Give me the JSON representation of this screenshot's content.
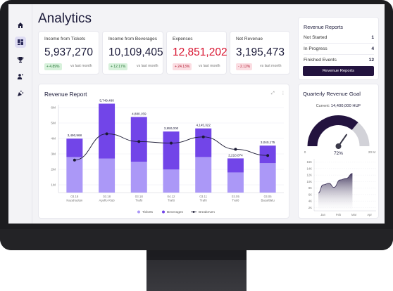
{
  "page": {
    "title": "Analytics"
  },
  "sidebar": {
    "icons": [
      "home-icon",
      "dashboard-icon",
      "trophy-icon",
      "users-icon",
      "party-icon"
    ]
  },
  "kpis": [
    {
      "label": "Income from Tickets",
      "value": "5,937,270",
      "badge": "+ 4.89%",
      "note": "vs last month",
      "trend": "up"
    },
    {
      "label": "Income from Beverages",
      "value": "10,109,405",
      "badge": "+ 12.17%",
      "note": "vs last month",
      "trend": "up"
    },
    {
      "label": "Expenses",
      "value": "12,851,202",
      "badge": "+ 24.13%",
      "note": "vs last month",
      "trend": "down"
    },
    {
      "label": "Net Revenue",
      "value": "3,195,473",
      "badge": "- 2.12%",
      "note": "vs last month",
      "trend": "down"
    }
  ],
  "revenue_reports": {
    "title": "Revenue Reports",
    "rows": [
      {
        "label": "Not Started",
        "value": "1"
      },
      {
        "label": "In Progress",
        "value": "4"
      },
      {
        "label": "Finished Events",
        "value": "12"
      }
    ],
    "button": "Revenue Reports"
  },
  "revenue_report_card": {
    "title": "Revenue Report"
  },
  "goal_card": {
    "title": "Quarterly Revenue Goal",
    "current_label": "Current:",
    "current_value": "14,400,000 HUF",
    "gauge_min": "0",
    "gauge_max": "20 M",
    "gauge_percent_label": "72%",
    "gauge_fraction": 0.72
  },
  "colors": {
    "tickets": "#ab98f7",
    "beverages": "#7245e8",
    "breakeven": "#1b1a33",
    "dark": "#23133f"
  },
  "chart_data": [
    {
      "type": "bar",
      "title": "Revenue Report",
      "categories": [
        [
          "03.18",
          "Kazahsztán"
        ],
        [
          "03.18",
          "Apollo Klub"
        ],
        [
          "03.18",
          "Trafó"
        ],
        [
          "04.12",
          "Trafó"
        ],
        [
          "03.11",
          "Trafó"
        ],
        [
          "03.05",
          "Trafó"
        ],
        [
          "03.05",
          "Bazaltfalu"
        ]
      ],
      "series": [
        {
          "name": "Tickets",
          "values": [
            2.3,
            2.2,
            2.0,
            1.5,
            2.3,
            1.3,
            1.9
          ]
        },
        {
          "name": "Beverages",
          "values": [
            1.19,
            3.55,
            2.89,
            2.45,
            1.85,
            0.91,
            1.14
          ]
        }
      ],
      "bar_labels": [
        "3,490,968",
        "5,749,480",
        "4,880,159",
        "3,950,000",
        "4,145,322",
        "2,210,074",
        "3,040,175"
      ],
      "line": {
        "name": "Breakeven",
        "values": [
          2.1,
          3.8,
          3.3,
          3.2,
          3.6,
          2.8,
          2.4
        ]
      },
      "yticks": [
        "1M",
        "2M",
        "3M",
        "4M",
        "5M",
        "6M"
      ],
      "ylim": [
        0.5,
        6
      ],
      "legend": "bottom"
    },
    {
      "type": "area",
      "categories": [
        "Jan",
        "Feb",
        "Mar",
        "Apr"
      ],
      "yticks": [
        "2K",
        "4K",
        "6K",
        "8K",
        "10K",
        "12K",
        "14K",
        "16K"
      ],
      "ylim": [
        1,
        17
      ],
      "x": [
        0,
        0.3,
        0.7,
        1.0,
        1.4,
        1.8,
        2.2
      ],
      "values": [
        6.5,
        9.0,
        9.5,
        8.2,
        10.5,
        11.0,
        12.5
      ]
    }
  ]
}
